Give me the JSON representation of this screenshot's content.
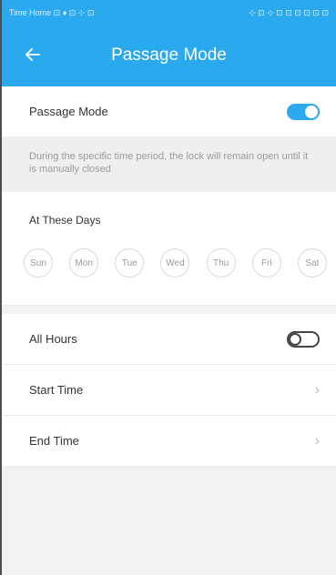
{
  "status_bar": {
    "left": "Time Home ⊡ ♦ ⊡ ⊹ ⊡",
    "right": "⊹ ⊡ ⊹ ⊡ ⊡ ⊡ ⊡ ⊡ ⊡"
  },
  "header": {
    "back_icon": "arrow-left-icon",
    "title": "Passage Mode"
  },
  "passage_mode": {
    "label": "Passage Mode",
    "enabled": true,
    "description": "During the specific time period, the lock will remain open until it is manually closed"
  },
  "days": {
    "label": "At These Days",
    "items": [
      "Sun",
      "Mon",
      "Tue",
      "Wed",
      "Thu",
      "Fri",
      "Sat"
    ]
  },
  "all_hours": {
    "label": "All Hours",
    "enabled": false
  },
  "start_time": {
    "label": "Start Time",
    "chevron": "›"
  },
  "end_time": {
    "label": "End Time",
    "chevron": "›"
  },
  "colors": {
    "accent": "#2aa9ee",
    "background": "#f2f2f2"
  }
}
